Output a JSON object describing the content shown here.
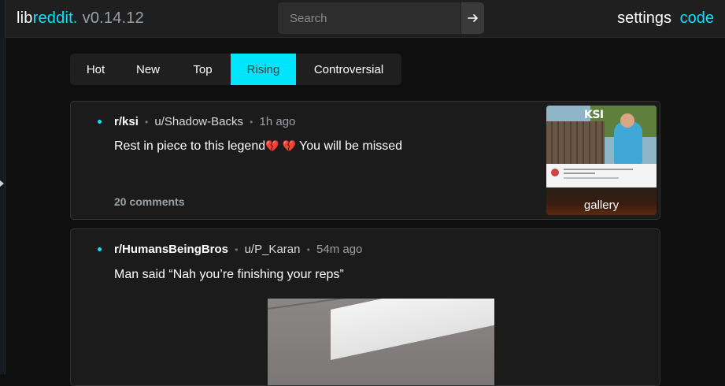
{
  "app": {
    "brand_lib": "lib",
    "brand_reddit": "reddit.",
    "version": "v0.14.12",
    "accent_color": "#00e5ff"
  },
  "search": {
    "placeholder": "Search",
    "button_icon": "arrow-right-icon"
  },
  "nav": {
    "settings": "settings",
    "code": "code"
  },
  "sort": {
    "tabs": [
      {
        "label": "Hot"
      },
      {
        "label": "New"
      },
      {
        "label": "Top"
      },
      {
        "label": "Rising"
      },
      {
        "label": "Controversial"
      }
    ],
    "active": "Rising"
  },
  "posts": [
    {
      "subreddit": "r/ksi",
      "author": "u/Shadow-Backs",
      "time": "1h ago",
      "title": "Rest in piece to this legend",
      "title_hearts": "💔 💔",
      "title_suffix": "You will be missed",
      "comments": "20 comments",
      "thumbnail_label": "gallery",
      "thumbnail_text": "KSI"
    },
    {
      "subreddit": "r/HumansBeingBros",
      "author": "u/P_Karan",
      "time": "54m ago",
      "title": "Man said “Nah you’re finishing your reps”"
    }
  ]
}
